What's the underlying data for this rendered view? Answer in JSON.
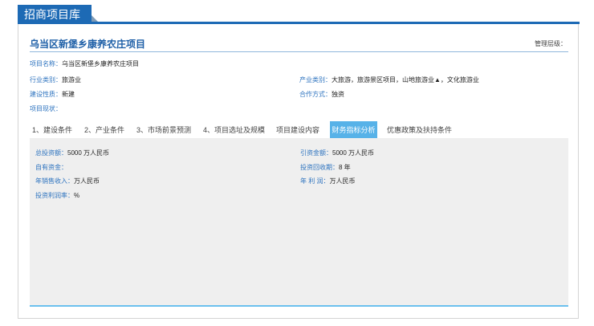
{
  "header": {
    "title": "招商项目库"
  },
  "project": {
    "title": "乌当区新堡乡康养农庄项目",
    "management_level_label": "管理层级："
  },
  "info": {
    "name_label": "项目名称：",
    "name_value": "乌当区新堡乡康养农庄项目",
    "industry_label": "行业类别：",
    "industry_value": "旅游业",
    "product_label": "产业类别：",
    "product_value": "大旅游，旅游景区项目，山地旅游业▲，文化旅游业",
    "construction_label": "建设性质：",
    "construction_value": "新建",
    "cooperation_label": "合作方式：",
    "cooperation_value": "独资",
    "status_label": "项目现状：",
    "status_value": ""
  },
  "tabs": [
    {
      "label": "1、建设条件"
    },
    {
      "label": "2、产业条件"
    },
    {
      "label": "3、市场前景预测"
    },
    {
      "label": "4、项目选址及规模"
    },
    {
      "label": "项目建设内容"
    },
    {
      "label": "财务指标分析"
    },
    {
      "label": "优惠政策及扶持条件"
    }
  ],
  "active_tab": "财务指标分析",
  "financial": {
    "total_investment_label": "总投资额：",
    "total_investment_value": "5000 万人民币",
    "attracted_label": "引资金额：",
    "attracted_value": "5000 万人民币",
    "own_funds_label": "自有资金：",
    "own_funds_value": "",
    "payback_label": "投资回收期：",
    "payback_value": "8 年",
    "annual_sales_label": "年销售收入：",
    "annual_sales_value": "万人民币",
    "annual_profit_label": "年 利 润：",
    "annual_profit_value": "万人民币",
    "roi_label": "投资利润率：",
    "roi_value": "%"
  },
  "colors": {
    "brand": "#1d6ab5",
    "active_tab": "#57b2e8",
    "label": "#2d73bf"
  }
}
